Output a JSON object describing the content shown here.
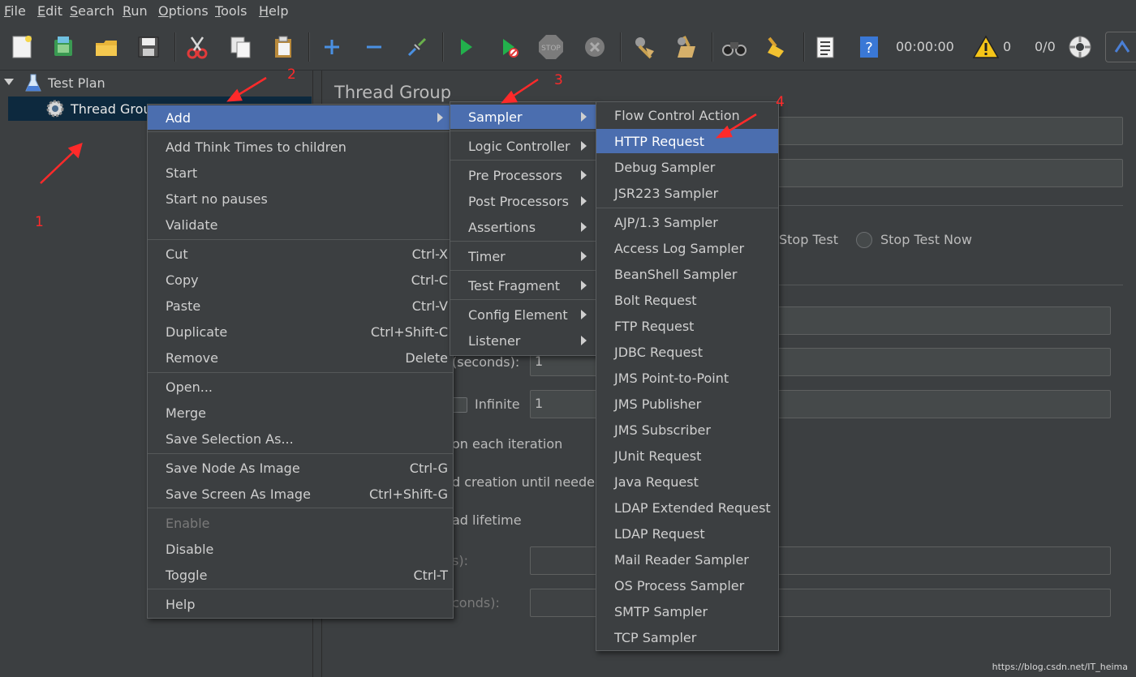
{
  "menubar": [
    {
      "label": "File",
      "u": "F",
      "rest": "ile"
    },
    {
      "label": "Edit",
      "u": "E",
      "rest": "dit"
    },
    {
      "label": "Search",
      "u": "S",
      "rest": "earch"
    },
    {
      "label": "Run",
      "u": "R",
      "rest": "un"
    },
    {
      "label": "Options",
      "u": "O",
      "rest": "ptions"
    },
    {
      "label": "Tools",
      "u": "T",
      "rest": "ools"
    },
    {
      "label": "Help",
      "u": "H",
      "rest": "elp"
    }
  ],
  "toolbar": {
    "timer": "00:00:00",
    "warn_count": "0",
    "ratio": "0/0",
    "stop_icon_text": "STOP"
  },
  "tree": {
    "test_plan": "Test Plan",
    "thread_group": "Thread Group"
  },
  "panel": {
    "title": "Thread Group",
    "stop_test": "Stop Test",
    "stop_test_now": "Stop Test Now",
    "rampup_label_partial": "(seconds):",
    "rampup_value": "1",
    "infinite_label": "Infinite",
    "loop_value": "1",
    "same_user_partial": "on each iteration",
    "delay_partial": "d creation until needed",
    "lifetime_partial": "ad lifetime",
    "duration_partial": "s):",
    "startup_partial": "conds):"
  },
  "context_menu": {
    "items": [
      {
        "label": "Add",
        "accel": "",
        "submenu": true,
        "selected": true,
        "disabled": false
      },
      {
        "label": "Add Think Times to children",
        "accel": "",
        "submenu": false,
        "selected": false,
        "disabled": false
      },
      {
        "label": "Start",
        "accel": "",
        "submenu": false,
        "selected": false,
        "disabled": false
      },
      {
        "label": "Start no pauses",
        "accel": "",
        "submenu": false,
        "selected": false,
        "disabled": false
      },
      {
        "label": "Validate",
        "accel": "",
        "submenu": false,
        "selected": false,
        "disabled": false
      },
      {
        "label": "Cut",
        "accel": "Ctrl-X",
        "submenu": false,
        "selected": false,
        "disabled": false
      },
      {
        "label": "Copy",
        "accel": "Ctrl-C",
        "submenu": false,
        "selected": false,
        "disabled": false
      },
      {
        "label": "Paste",
        "accel": "Ctrl-V",
        "submenu": false,
        "selected": false,
        "disabled": false
      },
      {
        "label": "Duplicate",
        "accel": "Ctrl+Shift-C",
        "submenu": false,
        "selected": false,
        "disabled": false
      },
      {
        "label": "Remove",
        "accel": "Delete",
        "submenu": false,
        "selected": false,
        "disabled": false
      },
      {
        "label": "Open...",
        "accel": "",
        "submenu": false,
        "selected": false,
        "disabled": false
      },
      {
        "label": "Merge",
        "accel": "",
        "submenu": false,
        "selected": false,
        "disabled": false
      },
      {
        "label": "Save Selection As...",
        "accel": "",
        "submenu": false,
        "selected": false,
        "disabled": false
      },
      {
        "label": "Save Node As Image",
        "accel": "Ctrl-G",
        "submenu": false,
        "selected": false,
        "disabled": false
      },
      {
        "label": "Save Screen As Image",
        "accel": "Ctrl+Shift-G",
        "submenu": false,
        "selected": false,
        "disabled": false
      },
      {
        "label": "Enable",
        "accel": "",
        "submenu": false,
        "selected": false,
        "disabled": true
      },
      {
        "label": "Disable",
        "accel": "",
        "submenu": false,
        "selected": false,
        "disabled": false
      },
      {
        "label": "Toggle",
        "accel": "Ctrl-T",
        "submenu": false,
        "selected": false,
        "disabled": false
      },
      {
        "label": "Help",
        "accel": "",
        "submenu": false,
        "selected": false,
        "disabled": false
      }
    ]
  },
  "add_submenu": {
    "items": [
      {
        "label": "Sampler",
        "selected": true
      },
      {
        "label": "Logic Controller",
        "selected": false
      },
      {
        "label": "Pre Processors",
        "selected": false
      },
      {
        "label": "Post Processors",
        "selected": false
      },
      {
        "label": "Assertions",
        "selected": false
      },
      {
        "label": "Timer",
        "selected": false
      },
      {
        "label": "Test Fragment",
        "selected": false
      },
      {
        "label": "Config Element",
        "selected": false
      },
      {
        "label": "Listener",
        "selected": false
      }
    ]
  },
  "sampler_submenu": {
    "items": [
      {
        "label": "Flow Control Action",
        "selected": false
      },
      {
        "label": "HTTP Request",
        "selected": true
      },
      {
        "label": "Debug Sampler",
        "selected": false
      },
      {
        "label": "JSR223 Sampler",
        "selected": false
      },
      {
        "label": "AJP/1.3 Sampler",
        "selected": false
      },
      {
        "label": "Access Log Sampler",
        "selected": false
      },
      {
        "label": "BeanShell Sampler",
        "selected": false
      },
      {
        "label": "Bolt Request",
        "selected": false
      },
      {
        "label": "FTP Request",
        "selected": false
      },
      {
        "label": "JDBC Request",
        "selected": false
      },
      {
        "label": "JMS Point-to-Point",
        "selected": false
      },
      {
        "label": "JMS Publisher",
        "selected": false
      },
      {
        "label": "JMS Subscriber",
        "selected": false
      },
      {
        "label": "JUnit Request",
        "selected": false
      },
      {
        "label": "Java Request",
        "selected": false
      },
      {
        "label": "LDAP Extended Request",
        "selected": false
      },
      {
        "label": "LDAP Request",
        "selected": false
      },
      {
        "label": "Mail Reader Sampler",
        "selected": false
      },
      {
        "label": "OS Process Sampler",
        "selected": false
      },
      {
        "label": "SMTP Sampler",
        "selected": false
      },
      {
        "label": "TCP Sampler",
        "selected": false
      }
    ]
  },
  "annotations": {
    "n1": "1",
    "n2": "2",
    "n3": "3",
    "n4": "4",
    "color": "#ff2a2a"
  },
  "watermark": "https://blog.csdn.net/IT_heima",
  "colors": {
    "background": "#3c3f41",
    "selection": "#4b6eaf",
    "tree_selection": "#0d293e",
    "text": "#cfcfcf"
  }
}
